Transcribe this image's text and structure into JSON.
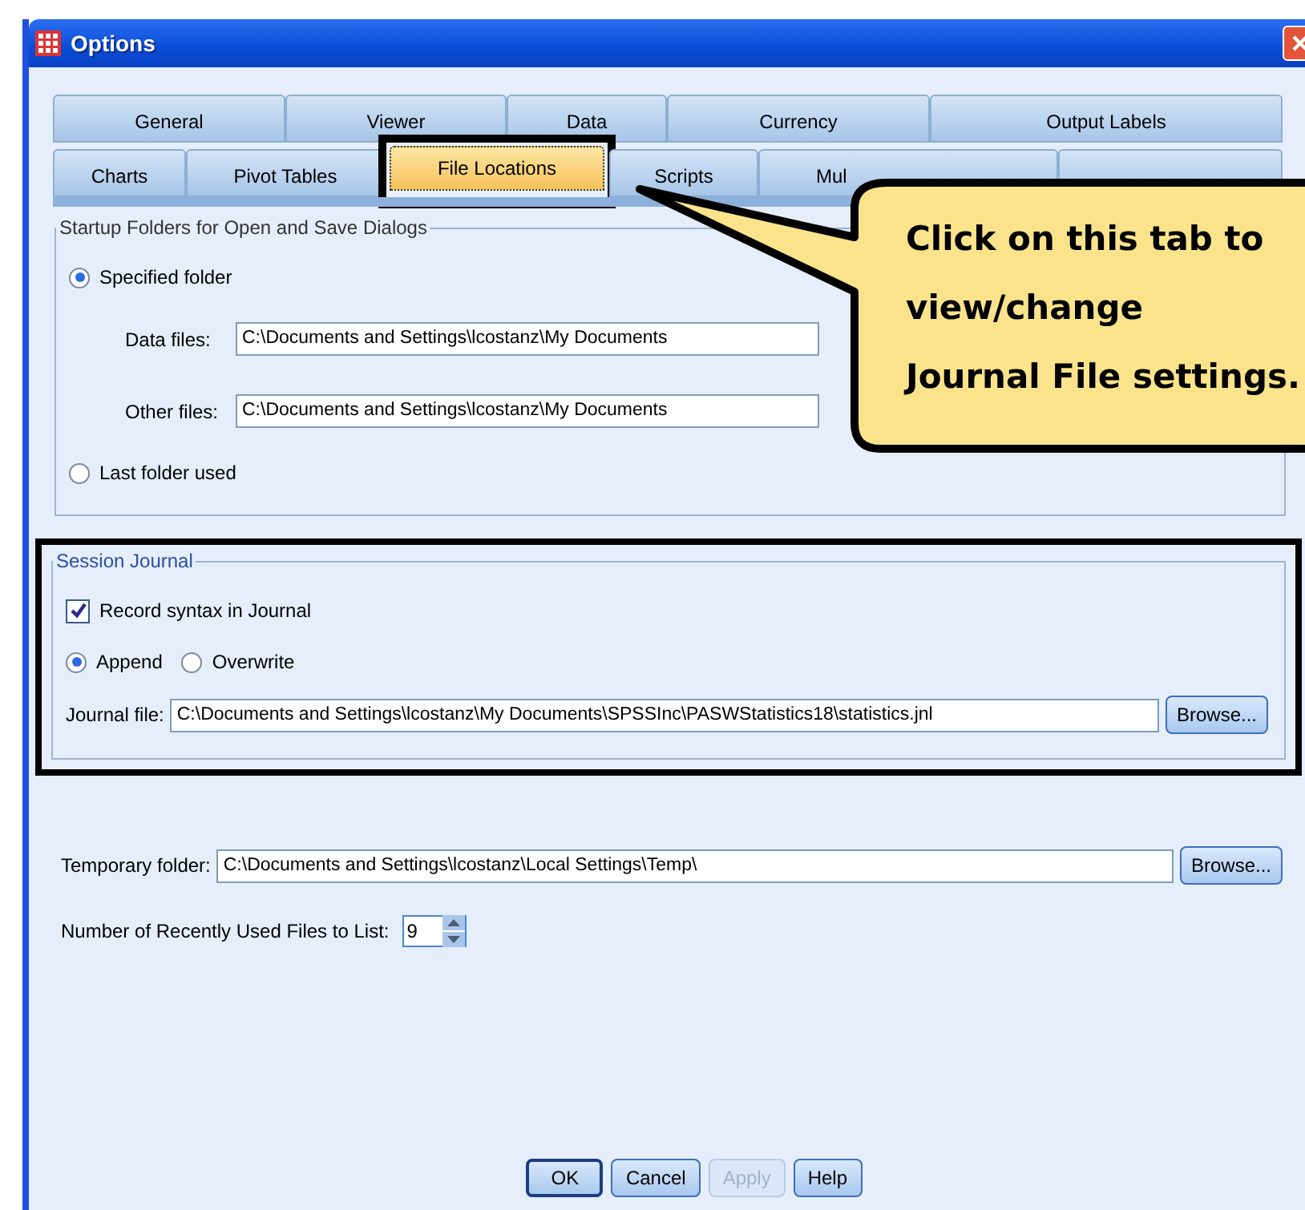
{
  "window": {
    "title": "Options"
  },
  "tab_rows": [
    {
      "tabs": [
        {
          "label": "General",
          "selected": false
        },
        {
          "label": "Viewer",
          "selected": false
        },
        {
          "label": "Data",
          "selected": false
        },
        {
          "label": "Currency",
          "selected": false
        },
        {
          "label": "Output Labels",
          "selected": false
        }
      ]
    },
    {
      "tabs": [
        {
          "label": "Charts",
          "selected": false
        },
        {
          "label": "Pivot Tables",
          "selected": false
        },
        {
          "label": "File Locations",
          "selected": true,
          "highlighted": true
        },
        {
          "label": "Scripts",
          "selected": false
        },
        {
          "label": "Mul",
          "selected": false
        },
        {
          "selected": false
        }
      ]
    }
  ],
  "startup_folders": {
    "title": "Startup Folders for Open and Save Dialogs",
    "options": [
      {
        "label": "Specified folder",
        "selected": true
      },
      {
        "label": "Last folder used",
        "selected": false
      }
    ],
    "fields": [
      {
        "label": "Data files:",
        "value": "C:\\Documents and Settings\\lcostanz\\My Documents"
      },
      {
        "label": "Other files:",
        "value": "C:\\Documents and Settings\\lcostanz\\My Documents"
      }
    ]
  },
  "session_journal": {
    "title": "Session Journal",
    "highlighted": true,
    "record": {
      "label": "Record syntax in Journal",
      "checked": true
    },
    "modes": [
      {
        "label": "Append",
        "selected": true
      },
      {
        "label": "Overwrite",
        "selected": false
      }
    ],
    "journal_file": {
      "label": "Journal file:",
      "value": "C:\\Documents and Settings\\lcostanz\\My Documents\\SPSSInc\\PASWStatistics18\\statistics.jnl",
      "button": "Browse..."
    }
  },
  "temporary_folder": {
    "label": "Temporary folder:",
    "value": "C:\\Documents and Settings\\lcostanz\\Local Settings\\Temp\\",
    "button": "Browse..."
  },
  "recent_files": {
    "label": "Number of Recently Used Files to List:",
    "value": "9"
  },
  "buttons": [
    {
      "label": "OK",
      "disabled": false,
      "default": true
    },
    {
      "label": "Cancel",
      "disabled": false,
      "default": false
    },
    {
      "label": "Apply",
      "disabled": true,
      "default": false
    },
    {
      "label": "Help",
      "disabled": false,
      "default": false
    }
  ],
  "callout": {
    "lines": [
      "Click on this tab to",
      "view/change",
      "Journal File settings."
    ]
  }
}
